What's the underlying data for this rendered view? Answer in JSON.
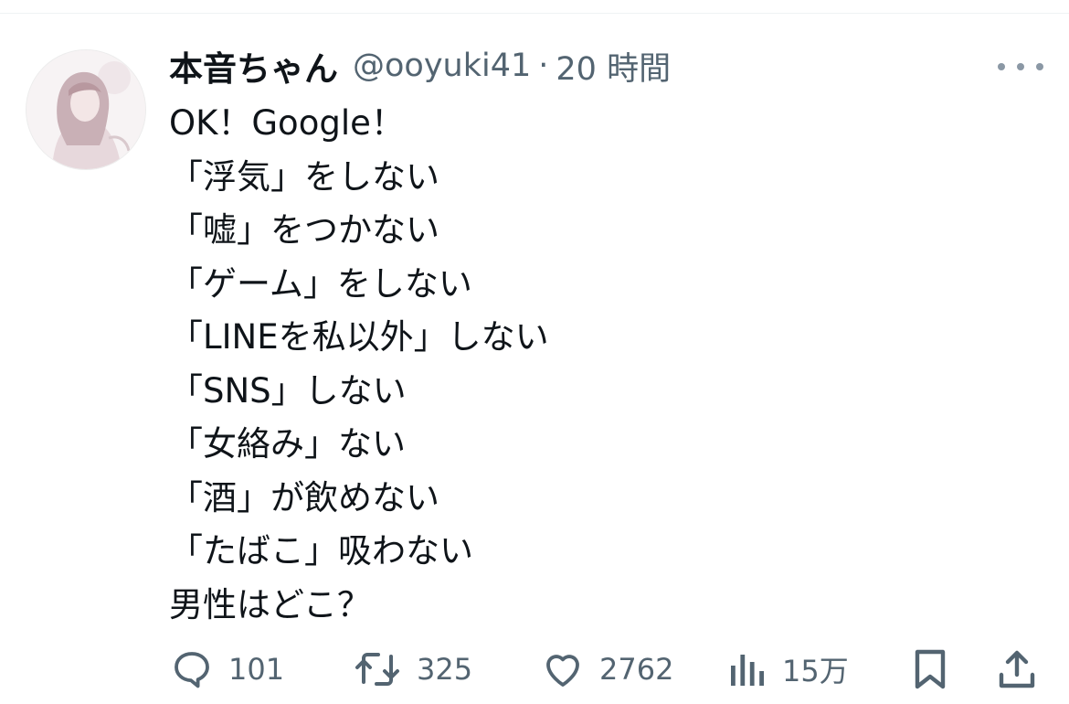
{
  "tweet": {
    "display_name": "本音ちゃん",
    "handle": "@ooyuki41",
    "separator": "·",
    "timestamp": "20 時間",
    "lines": [
      "OK！Google！",
      "「浮気」をしない",
      "「嘘」をつかない",
      "「ゲーム」をしない",
      "「LINEを私以外」しない",
      "「SNS」しない",
      "「女絡み」ない",
      "「酒」が飲めない",
      "「たばこ」吸わない",
      "男性はどこ？"
    ]
  },
  "actions": {
    "replies": "101",
    "reposts": "325",
    "likes": "2762",
    "views": "15万"
  },
  "icons": {
    "reply": "reply-icon",
    "repost": "repost-icon",
    "like": "heart-icon",
    "views": "views-icon",
    "bookmark": "bookmark-icon",
    "share": "share-icon",
    "more": "more-icon"
  },
  "colors": {
    "text": "#0f1419",
    "secondary": "#536471",
    "divider": "#eff3f4"
  }
}
